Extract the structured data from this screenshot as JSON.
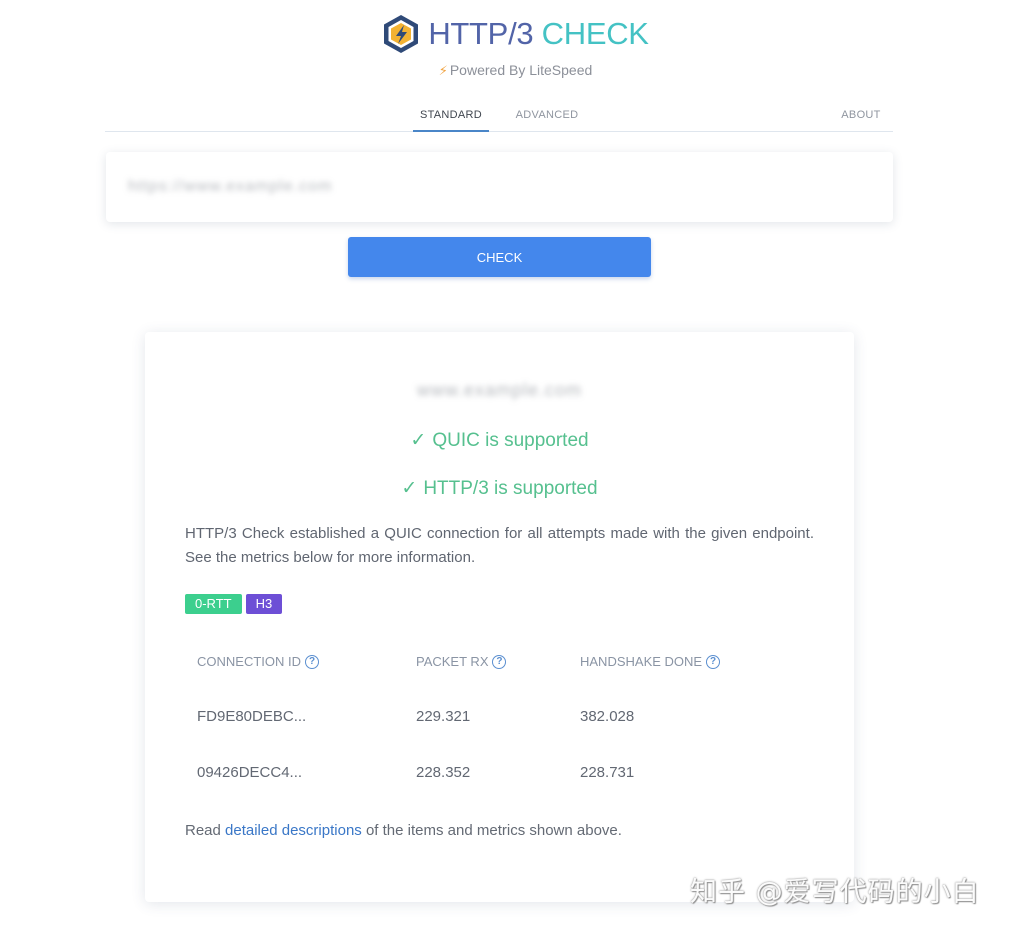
{
  "header": {
    "brand_part1": "HTTP/3",
    "brand_part2": "CHECK",
    "powered_by": "Powered By LiteSpeed"
  },
  "nav": {
    "tabs": [
      {
        "label": "STANDARD",
        "active": true
      },
      {
        "label": "ADVANCED",
        "active": false
      },
      {
        "label": "ABOUT",
        "active": false
      }
    ]
  },
  "search": {
    "input_value": "https://www.example.com",
    "button_label": "CHECK"
  },
  "result": {
    "host": "www.example.com",
    "quic_status": "QUIC is supported",
    "http3_status": "HTTP/3 is supported",
    "description": "HTTP/3 Check established a QUIC connection for all attempts made with the given endpoint. See the metrics below for more information.",
    "badges": [
      "0-RTT",
      "H3"
    ],
    "metrics": {
      "headers": [
        "CONNECTION ID",
        "PACKET RX",
        "HANDSHAKE DONE"
      ],
      "rows": [
        [
          "FD9E80DEBC...",
          "229.321",
          "382.028"
        ],
        [
          "09426DECC4...",
          "228.352",
          "228.731"
        ]
      ]
    },
    "read_prefix": "Read ",
    "read_link": "detailed descriptions",
    "read_suffix": " of the items and metrics shown above."
  },
  "watermark": "知乎 @爱写代码的小白",
  "colors": {
    "brand_blue": "#5264a8",
    "brand_teal": "#44c2c4",
    "button": "#4487ec",
    "success": "#56c08f",
    "badge_rtt": "#3ccf8e",
    "badge_h3": "#6d4fd6"
  }
}
